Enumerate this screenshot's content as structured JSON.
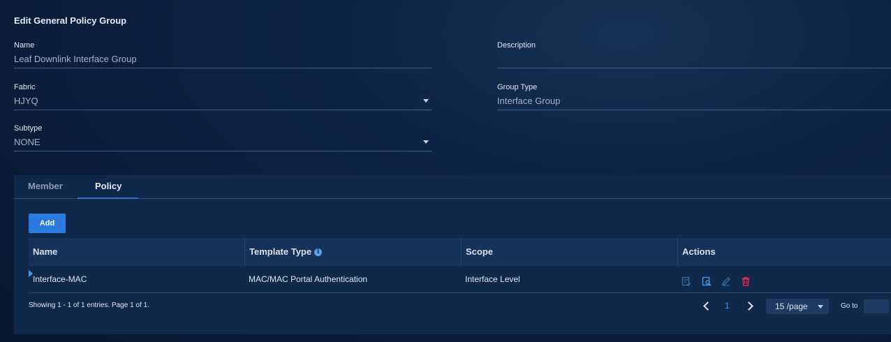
{
  "page": {
    "title": "Edit General Policy Group"
  },
  "form": {
    "name": {
      "label": "Name",
      "value": "Leaf Downlink Interface Group"
    },
    "description": {
      "label": "Description",
      "value": ""
    },
    "fabric": {
      "label": "Fabric",
      "value": "HJYQ"
    },
    "group_type": {
      "label": "Group Type",
      "value": "Interface Group"
    },
    "subtype": {
      "label": "Subtype",
      "value": "NONE"
    }
  },
  "tabs": [
    {
      "label": "Member",
      "active": false
    },
    {
      "label": "Policy",
      "active": true
    }
  ],
  "toolbar": {
    "add_label": "Add"
  },
  "table": {
    "columns": [
      "Name",
      "Template Type",
      "Scope",
      "Actions"
    ],
    "rows": [
      {
        "name": "Interface-MAC",
        "template_type": "MAC/MAC Portal Authentication",
        "scope": "Interface Level"
      }
    ],
    "actions": [
      "apply-icon",
      "view-details-icon",
      "edit-icon",
      "delete-icon"
    ]
  },
  "pagination": {
    "summary": "Showing 1 - 1 of 1 entries. Page 1 of 1.",
    "current_page": "1",
    "page_size": "15 /page",
    "goto_label": "Go to"
  },
  "colors": {
    "accent": "#2a7be0",
    "delete": "#e0304a",
    "background": "#0a1c38"
  }
}
